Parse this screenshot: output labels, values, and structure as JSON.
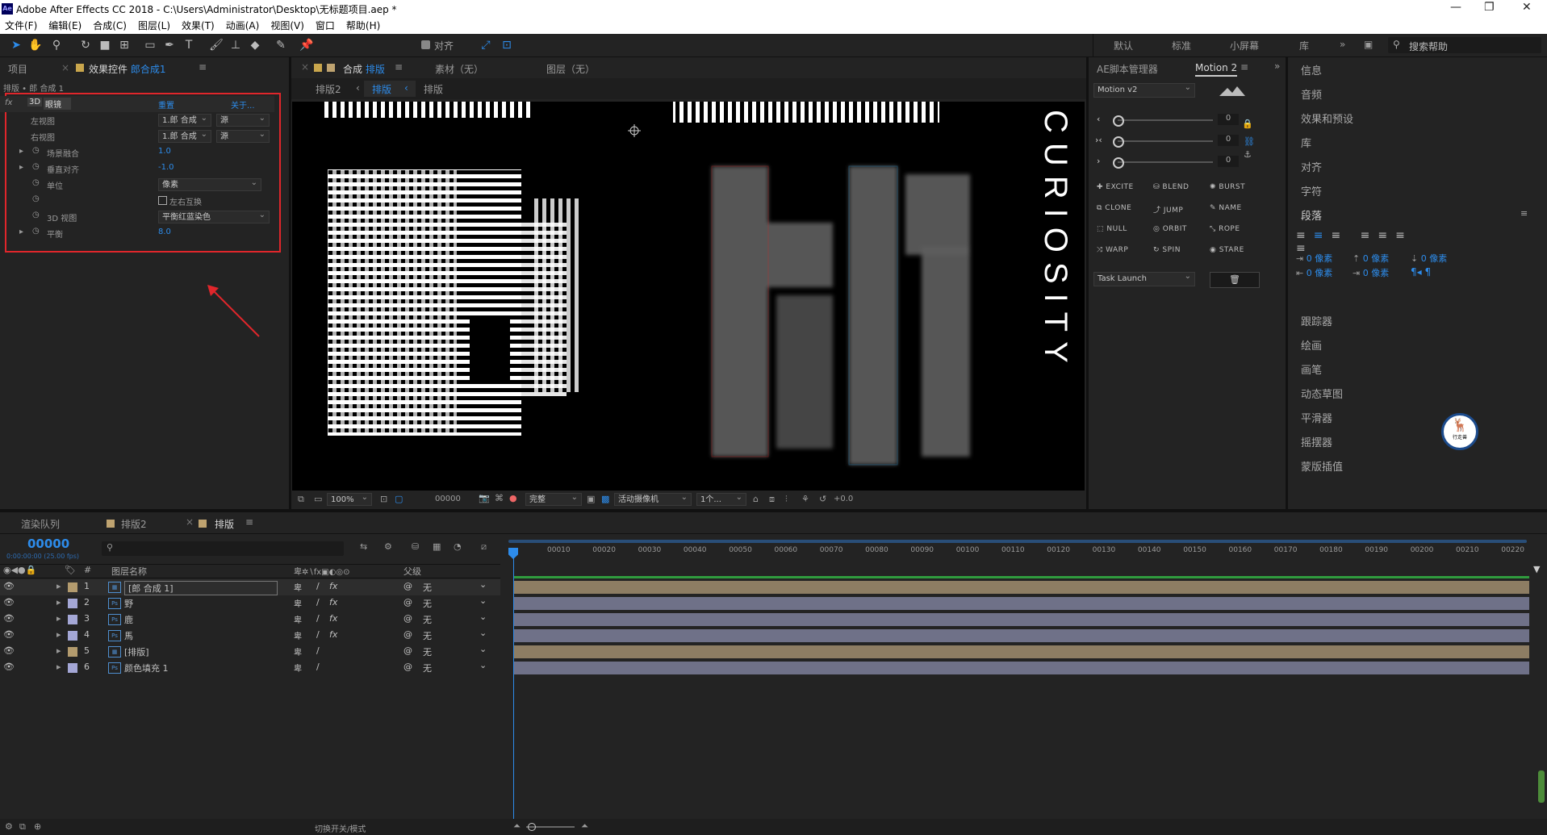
{
  "window": {
    "title": "Adobe After Effects CC 2018 - C:\\Users\\Administrator\\Desktop\\无标题项目.aep *",
    "app_badge": "Ae"
  },
  "menu": [
    "文件(F)",
    "编辑(E)",
    "合成(C)",
    "图层(L)",
    "效果(T)",
    "动画(A)",
    "视图(V)",
    "窗口",
    "帮助(H)"
  ],
  "toolbar": {
    "snap_label": "对齐"
  },
  "workspaces": [
    "默认",
    "标准",
    "小屏幕",
    "库"
  ],
  "search_help": "搜索帮助",
  "project_panel": {
    "tab_project": "项目",
    "tab_effects": "效果控件",
    "effects_target": "郎合成1",
    "breadcrumb": "排版 • 郎 合成 1",
    "effect": {
      "badge": "fx",
      "name_badge": "3D",
      "name": "眼镜",
      "reset": "重置",
      "about": "关于...",
      "props": [
        {
          "label": "左视图",
          "value1": "1.郎 合成",
          "value2": "源"
        },
        {
          "label": "右视图",
          "value1": "1.郎 合成",
          "value2": "源"
        },
        {
          "label": "场景融合",
          "value": "1.0"
        },
        {
          "label": "垂直对齐",
          "value": "-1.0"
        },
        {
          "label": "单位",
          "value": "像素"
        },
        {
          "label": "",
          "checkbox": "左右互换"
        },
        {
          "label": "3D 视图",
          "value": "平衡红蓝染色"
        },
        {
          "label": "平衡",
          "value": "8.0"
        }
      ]
    }
  },
  "comp_panel": {
    "tab_comp": "合成",
    "comp_name": "排版",
    "tab_footage": "素材（无）",
    "tab_layer": "图层（无）",
    "subtabs": [
      "排版2",
      "排版",
      "排版"
    ],
    "side_text": "CURIOSITY",
    "controls": {
      "zoom": "100%",
      "timecode": "00000",
      "resolution": "完整",
      "camera": "活动摄像机",
      "views": "1个...",
      "exposure": "+0.0"
    }
  },
  "motion_panel": {
    "tab_scripts": "AE脚本管理器",
    "tab_motion": "Motion 2",
    "version": "Motion v2",
    "sliders": [
      {
        "icon": "‹",
        "value": "0"
      },
      {
        "icon": "›‹",
        "value": "0"
      },
      {
        "icon": "›",
        "value": "0"
      }
    ],
    "buttons": [
      "EXCITE",
      "BLEND",
      "BURST",
      "CLONE",
      "JUMP",
      "NAME",
      "NULL",
      "ORBIT",
      "ROPE",
      "WARP",
      "SPIN",
      "STARE"
    ],
    "task": "Task Launch"
  },
  "right_panel": {
    "items_top": [
      "信息",
      "音频",
      "效果和预设",
      "库",
      "对齐",
      "字符"
    ],
    "paragraph_title": "段落",
    "indent_values": [
      "0 像素",
      "0 像素",
      "0 像素",
      "0 像素",
      "0 像素"
    ],
    "items_bottom": [
      "跟踪器",
      "绘画",
      "画笔",
      "动态草图",
      "平滑器",
      "摇摆器",
      "蒙版插值"
    ],
    "logo_text": "行走兽"
  },
  "timeline": {
    "tabs": [
      "渲染队列",
      "排版2",
      "排版"
    ],
    "timecode": "00000",
    "fps": "0:00:00:00 (25.00 fps)",
    "col_name": "图层名称",
    "col_parent": "父级",
    "col_hash": "#",
    "ruler": [
      "00010",
      "00020",
      "00030",
      "00040",
      "00050",
      "00060",
      "00070",
      "00080",
      "00090",
      "00100",
      "00110",
      "00120",
      "00130",
      "00140",
      "00150",
      "00160",
      "00170",
      "00180",
      "00190",
      "00200",
      "00210",
      "00220"
    ],
    "layers": [
      {
        "num": "1",
        "name": "[郎 合成 1]",
        "parent": "无",
        "color": "#b39b6e",
        "fx": true,
        "kind": "comp"
      },
      {
        "num": "2",
        "name": "野",
        "parent": "无",
        "color": "#a4a7d6",
        "fx": true,
        "kind": "ps"
      },
      {
        "num": "3",
        "name": "鹿",
        "parent": "无",
        "color": "#a4a7d6",
        "fx": true,
        "kind": "ps"
      },
      {
        "num": "4",
        "name": "馬",
        "parent": "无",
        "color": "#a4a7d6",
        "fx": true,
        "kind": "ps"
      },
      {
        "num": "5",
        "name": "[排版]",
        "parent": "无",
        "color": "#b39b6e",
        "fx": false,
        "kind": "comp"
      },
      {
        "num": "6",
        "name": "颜色填充 1",
        "parent": "无",
        "color": "#a4a7d6",
        "fx": false,
        "kind": "ps"
      }
    ],
    "footer": "切换开关/模式"
  },
  "colors": {
    "accent": "#2d8ceb",
    "highlight_box": "#e0262b",
    "comp_bar": "#8d7d63",
    "ps_bar": "#6f7188"
  }
}
